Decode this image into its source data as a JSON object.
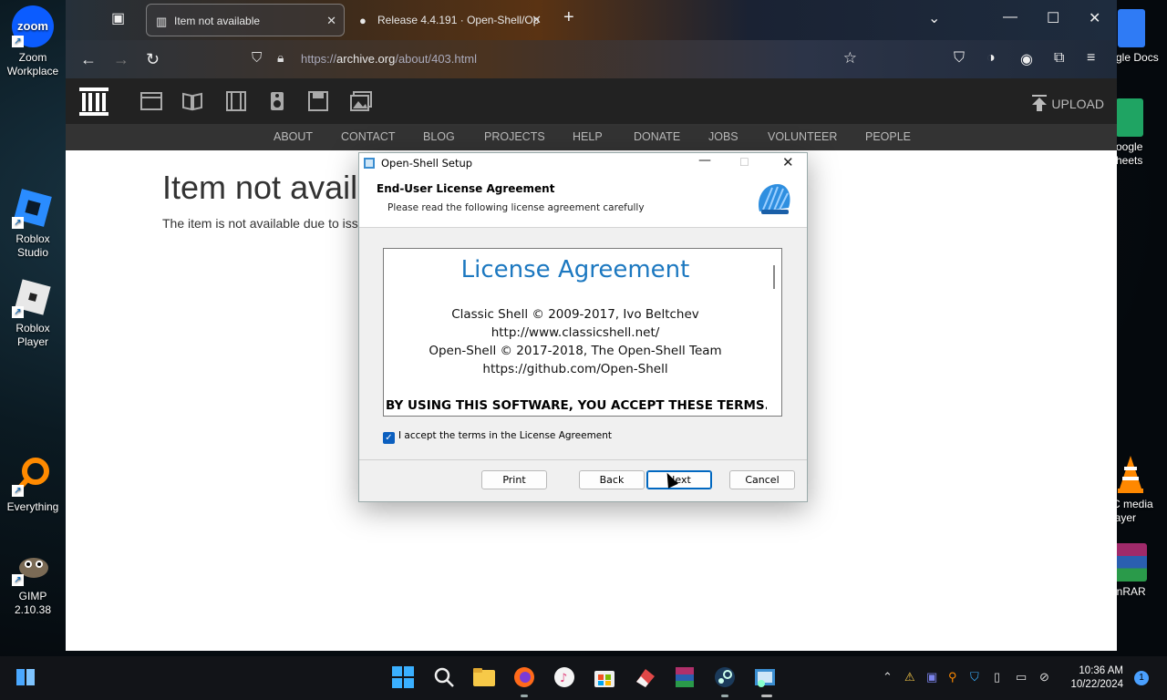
{
  "desktop": {
    "icons_left": [
      {
        "label_1": "Zoom",
        "label_2": "Workplace",
        "icon": "zoom-icon"
      },
      {
        "label_1": "Roblox",
        "label_2": "Studio",
        "icon": "roblox-studio-icon"
      },
      {
        "label_1": "Roblox",
        "label_2": "Player",
        "icon": "roblox-player-icon"
      },
      {
        "label_1": "Everything",
        "label_2": "",
        "icon": "everything-search-icon"
      },
      {
        "label_1": "GIMP 2.10.38",
        "label_2": "",
        "icon": "gimp-icon"
      }
    ],
    "icons_right": [
      {
        "label_1": "gle Docs",
        "label_2": "",
        "icon": "google-docs-icon"
      },
      {
        "label_1": "oogle",
        "label_2": "heets",
        "icon": "google-sheets-icon"
      },
      {
        "label_1": "C media",
        "label_2": "layer",
        "icon": "vlc-icon"
      },
      {
        "label_1": "inRAR",
        "label_2": "",
        "icon": "winrar-icon"
      }
    ]
  },
  "browser": {
    "tabs": [
      {
        "title": "Item not available",
        "active": true
      },
      {
        "title": "Release 4.4.191 · Open-Shell/Op",
        "active": false
      }
    ],
    "url_prefix": "https://",
    "url_host": "archive.org",
    "url_path": "/about/403.html"
  },
  "archive": {
    "upload_label": "UPLOAD",
    "menu": [
      "ABOUT",
      "CONTACT",
      "BLOG",
      "PROJECTS",
      "HELP",
      "DONATE",
      "JOBS",
      "VOLUNTEER",
      "PEOPLE"
    ],
    "page_title": "Item not avail",
    "page_message": "The item is not available due to iss"
  },
  "dialog": {
    "window_title": "Open-Shell Setup",
    "header_title": "End-User License Agreement",
    "header_subtitle": "Please read the following license agreement carefully",
    "license_heading": "License Agreement",
    "license_lines": [
      "Classic Shell © 2009-2017, Ivo Beltchev",
      "http://www.classicshell.net/",
      "Open-Shell © 2017-2018, The Open-Shell Team",
      "https://github.com/Open-Shell"
    ],
    "license_bold": "BY USING THIS SOFTWARE, YOU ACCEPT THESE TERMS. IF",
    "accept_label": "I accept the terms in the License Agreement",
    "accept_checked": true,
    "buttons": {
      "print": "Print",
      "back": "Back",
      "next": "Next",
      "cancel": "Cancel"
    }
  },
  "taskbar": {
    "time": "10:36 AM",
    "date": "10/22/2024",
    "notification_count": "1"
  }
}
